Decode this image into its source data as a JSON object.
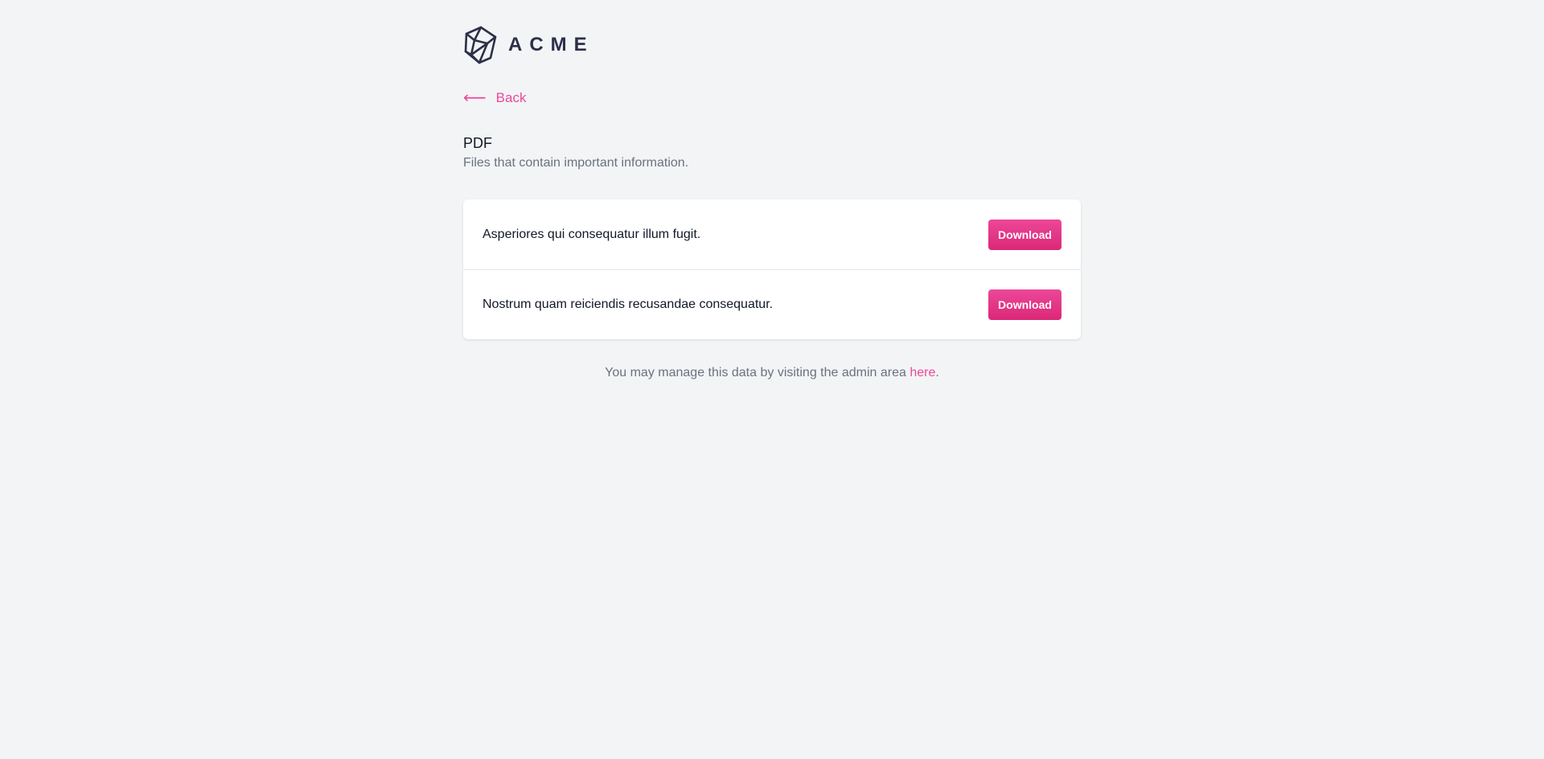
{
  "brand": {
    "logo_text": "ACME",
    "logo_icon": "cube-icon",
    "color": "#2d3047"
  },
  "nav": {
    "back_icon": "arrow-left-icon",
    "back_arrow": "⟵",
    "back_label": "Back"
  },
  "header": {
    "title": "PDF",
    "subtitle": "Files that contain important information."
  },
  "files": [
    {
      "title": "Asperiores qui consequatur illum fugit.",
      "action_label": "Download"
    },
    {
      "title": "Nostrum quam reiciendis recusandae consequatur.",
      "action_label": "Download"
    }
  ],
  "footer": {
    "text": "You may manage this data by visiting the admin area ",
    "link_label": "here",
    "suffix": "."
  },
  "colors": {
    "accent": "#ec4899",
    "background": "#f3f4f6",
    "muted_text": "#6b7280"
  }
}
